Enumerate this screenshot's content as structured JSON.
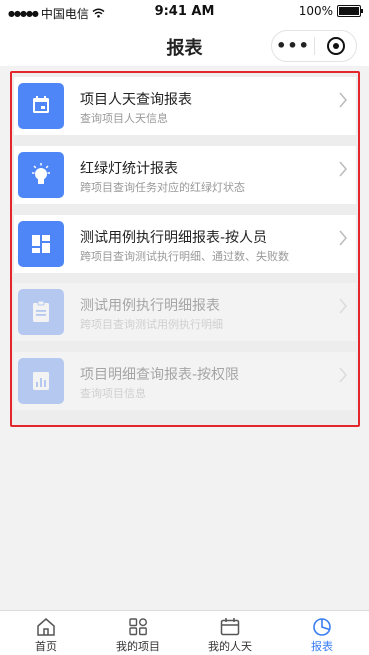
{
  "status_bar": {
    "signal": "●●●●●",
    "carrier": "中国电信",
    "time": "9:41 AM",
    "battery": "100%",
    "battery_level": 1.0
  },
  "nav": {
    "title": "报表",
    "more_label": "•••"
  },
  "reports": [
    {
      "title": "项目人天查询报表",
      "desc": "查询项目人天信息",
      "icon": "calendar-icon",
      "enabled": true
    },
    {
      "title": "红绿灯统计报表",
      "desc": "跨项目查询任务对应的红绿灯状态",
      "icon": "lightbulb-icon",
      "enabled": true
    },
    {
      "title": "测试用例执行明细报表-按人员",
      "desc": "跨项目查询测试执行明细、通过数、失败数",
      "icon": "dashboard-icon",
      "enabled": true
    },
    {
      "title": "测试用例执行明细报表",
      "desc": "跨项目查询测试用例执行明细",
      "icon": "clipboard-icon",
      "enabled": false
    },
    {
      "title": "项目明细查询报表-按权限",
      "desc": "查询项目信息",
      "icon": "bar-chart-icon",
      "enabled": false
    }
  ],
  "tabs": [
    {
      "label": "首页",
      "icon": "home-icon",
      "active": false
    },
    {
      "label": "我的项目",
      "icon": "apps-icon",
      "active": false
    },
    {
      "label": "我的人天",
      "icon": "calendar-icon",
      "active": false
    },
    {
      "label": "报表",
      "icon": "pie-chart-icon",
      "active": true
    }
  ],
  "colors": {
    "accent": "#3a7df3",
    "icon_bg": "#4f86f7",
    "highlight_border": "#e3262b"
  }
}
